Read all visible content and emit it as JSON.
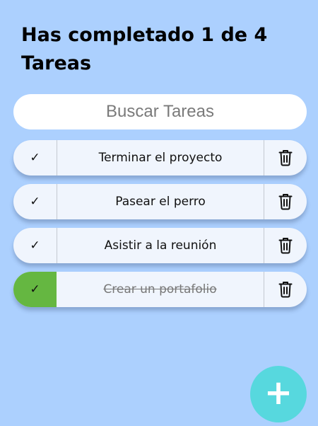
{
  "header": {
    "title": "Has completado 1 de 4 Tareas"
  },
  "search": {
    "placeholder": "Buscar Tareas",
    "value": ""
  },
  "todos": [
    {
      "text": "Terminar el proyecto",
      "completed": false,
      "check_icon": "✓"
    },
    {
      "text": "Pasear el perro",
      "completed": false,
      "check_icon": "✓"
    },
    {
      "text": "Asistir a la reunión",
      "completed": false,
      "check_icon": "✓"
    },
    {
      "text": "Crear un portafolio",
      "completed": true,
      "check_icon": "✓"
    }
  ],
  "add_button": {
    "icon": "plus-icon",
    "symbol": "+"
  },
  "colors": {
    "background": "#acd0fe",
    "item_background": "#f0f5fd",
    "completed_check": "#65b741",
    "add_button": "#57d8de"
  }
}
